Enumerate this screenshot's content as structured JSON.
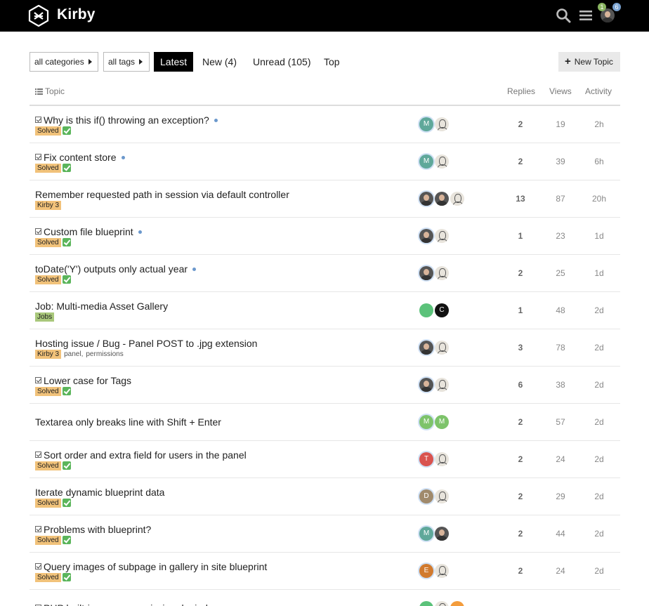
{
  "header": {
    "app_name": "Kirby",
    "notifications": {
      "green": "1",
      "blue": "6"
    }
  },
  "nav": {
    "categories": "all categories",
    "tags": "all tags",
    "tabs": [
      "Latest",
      "New (4)",
      "Unread (105)",
      "Top"
    ],
    "new_topic": "New Topic"
  },
  "columns": {
    "topic": "Topic",
    "replies": "Replies",
    "views": "Views",
    "activity": "Activity"
  },
  "colors": {
    "header_bg": "#000000",
    "solved_badge": "#f1c27a",
    "jobs_badge": "#a9c87b",
    "unread_dot": "#6b98cc"
  },
  "topics": [
    {
      "title": "Why is this if() throwing an exception?",
      "solved_icon": true,
      "unread": true,
      "badge": "Solved",
      "tags": [],
      "posters": [
        "M",
        "sketch"
      ],
      "replies": "2",
      "views": "19",
      "activity": "2h"
    },
    {
      "title": "Fix content store",
      "solved_icon": true,
      "unread": true,
      "badge": "Solved",
      "tags": [],
      "posters": [
        "M",
        "sketch"
      ],
      "replies": "2",
      "views": "39",
      "activity": "6h"
    },
    {
      "title": "Remember requested path in session via default controller",
      "solved_icon": false,
      "unread": false,
      "badge": "Kirby 3",
      "tags": [],
      "posters": [
        "photo",
        "photo",
        "sketch"
      ],
      "replies": "13",
      "views": "87",
      "activity": "20h"
    },
    {
      "title": "Custom file blueprint",
      "solved_icon": true,
      "unread": true,
      "badge": "Solved",
      "tags": [],
      "posters": [
        "photo",
        "sketch"
      ],
      "replies": "1",
      "views": "23",
      "activity": "1d"
    },
    {
      "title": "toDate('Y') outputs only actual year",
      "solved_icon": false,
      "unread": true,
      "badge": "Solved",
      "tags": [],
      "posters": [
        "photo",
        "sketch"
      ],
      "replies": "2",
      "views": "25",
      "activity": "1d"
    },
    {
      "title": "Job: Multi-media Asset Gallery",
      "solved_icon": false,
      "unread": false,
      "badge": "Jobs",
      "tags": [],
      "posters": [
        "green",
        "C"
      ],
      "replies": "1",
      "views": "48",
      "activity": "2d"
    },
    {
      "title": "Hosting issue / Bug - Panel POST to .jpg extension",
      "solved_icon": false,
      "unread": false,
      "badge": "Kirby 3",
      "tags": [
        "panel",
        "permissions"
      ],
      "posters": [
        "photo",
        "sketch"
      ],
      "replies": "3",
      "views": "78",
      "activity": "2d"
    },
    {
      "title": "Lower case for Tags",
      "solved_icon": true,
      "unread": false,
      "badge": "Solved",
      "tags": [],
      "posters": [
        "photo",
        "sketch"
      ],
      "replies": "6",
      "views": "38",
      "activity": "2d"
    },
    {
      "title": "Textarea only breaks line with Shift + Enter",
      "solved_icon": false,
      "unread": false,
      "badge": "",
      "tags": [],
      "posters": [
        "M",
        "M"
      ],
      "replies": "2",
      "views": "57",
      "activity": "2d"
    },
    {
      "title": "Sort order and extra field for users in the panel",
      "solved_icon": true,
      "unread": false,
      "badge": "Solved",
      "tags": [],
      "posters": [
        "T",
        "sketch"
      ],
      "replies": "2",
      "views": "24",
      "activity": "2d"
    },
    {
      "title": "Iterate dynamic blueprint data",
      "solved_icon": false,
      "unread": false,
      "badge": "Solved",
      "tags": [],
      "posters": [
        "D",
        "sketch"
      ],
      "replies": "2",
      "views": "29",
      "activity": "2d"
    },
    {
      "title": "Problems with blueprint?",
      "solved_icon": true,
      "unread": false,
      "badge": "Solved",
      "tags": [],
      "posters": [
        "M",
        "photo"
      ],
      "replies": "2",
      "views": "44",
      "activity": "2d"
    },
    {
      "title": "Query images of subpage in gallery in site blueprint",
      "solved_icon": true,
      "unread": false,
      "badge": "Solved",
      "tags": [],
      "posters": [
        "E",
        "sketch"
      ],
      "replies": "2",
      "views": "24",
      "activity": "2d"
    },
    {
      "title": "PHP built-in server permission denied",
      "solved_icon": true,
      "unread": false,
      "badge": "",
      "tags": [],
      "posters": [
        "green",
        "sketch",
        "orange"
      ],
      "replies": "",
      "views": "",
      "activity": ""
    }
  ]
}
